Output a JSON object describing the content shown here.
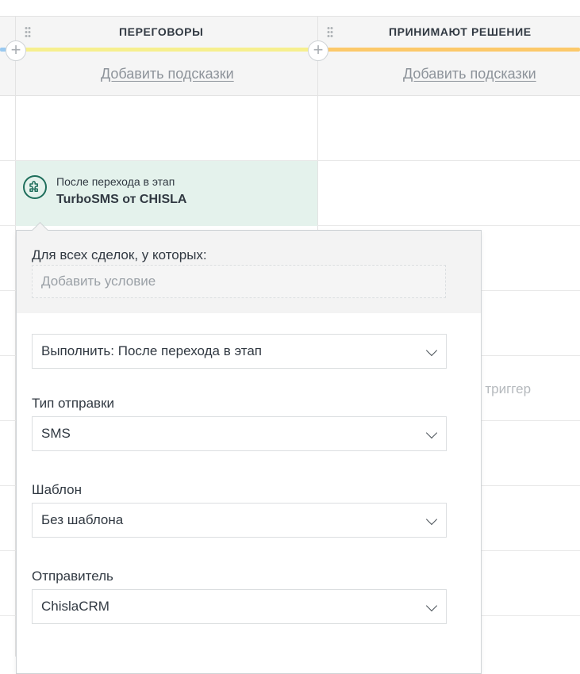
{
  "columns": [
    {
      "title": "ПЕРЕГОВОРЫ",
      "hint_link": "Добавить подсказки",
      "bar_color": "#f6ef8e"
    },
    {
      "title": "ПРИНИМАЮТ РЕШЕНИЕ",
      "hint_link": "Добавить подсказки",
      "bar_color": "#fcc96a"
    }
  ],
  "left_bar_color": "#99c9f0",
  "trigger_card": {
    "subtitle": "После перехода в этап",
    "name": "TurboSMS от CHISLA",
    "icon": "puzzle-icon"
  },
  "background_trigger_text": "ть триггер",
  "popup": {
    "condition_label": "Для всех сделок, у которых:",
    "condition_placeholder": "Добавить условие",
    "execute_select": "Выполнить: После перехода в этап",
    "send_type_label": "Тип отправки",
    "send_type_value": "SMS",
    "template_label": "Шаблон",
    "template_value": "Без шаблона",
    "sender_label": "Отправитель",
    "sender_value": "ChislaCRM"
  }
}
